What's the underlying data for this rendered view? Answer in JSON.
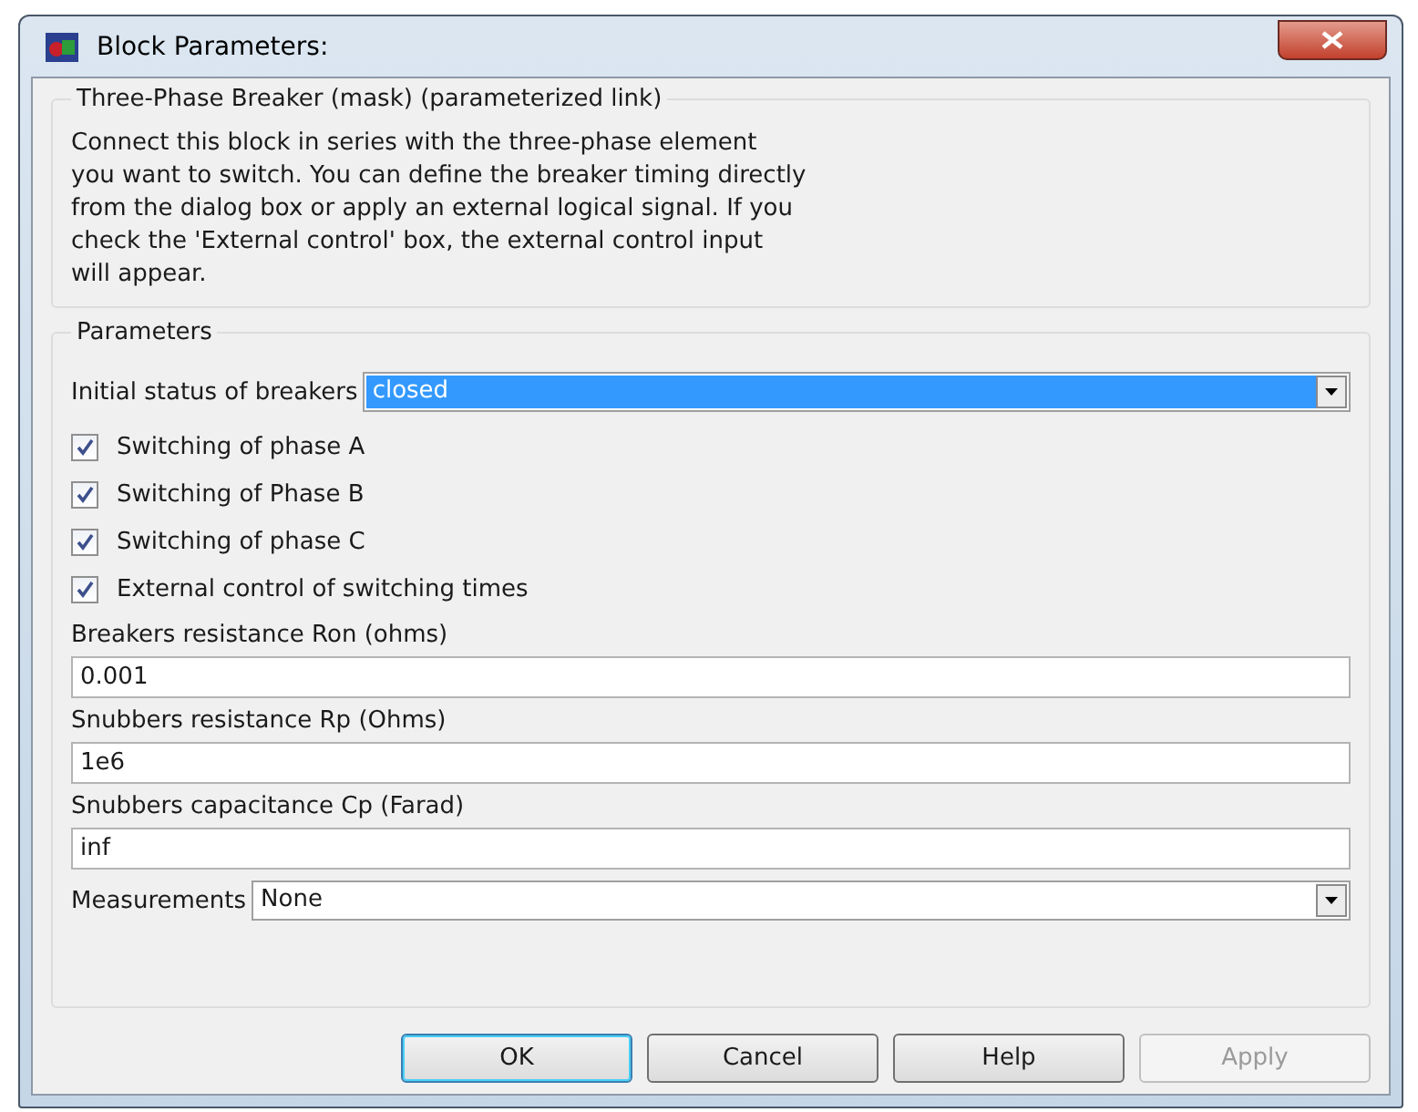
{
  "window": {
    "title": "Block Parameters:"
  },
  "description_group": {
    "title": "Three-Phase Breaker (mask) (parameterized link)",
    "text": "Connect this block in series with the three-phase element\nyou want to switch. You can define the breaker timing directly\nfrom the dialog box or apply an external logical signal. If you\ncheck  the 'External control' box, the external control input\nwill appear."
  },
  "parameters": {
    "title": "Parameters",
    "items": [
      {
        "kind": "dropdown",
        "label": "Initial status of breakers",
        "value": "closed",
        "focused": true
      },
      {
        "kind": "checkbox",
        "label": "Switching of phase A",
        "checked": true
      },
      {
        "kind": "checkbox",
        "label": "Switching of Phase B",
        "checked": true
      },
      {
        "kind": "checkbox",
        "label": "Switching of phase C",
        "checked": true
      },
      {
        "kind": "checkbox",
        "label": "External control of switching times",
        "checked": true
      },
      {
        "kind": "text",
        "label": "Breakers resistance Ron (ohms)",
        "value": "0.001"
      },
      {
        "kind": "text",
        "label": "Snubbers resistance Rp (Ohms)",
        "value": "1e6"
      },
      {
        "kind": "text",
        "label": "Snubbers capacitance Cp (Farad)",
        "value": "inf"
      },
      {
        "kind": "dropdown",
        "label": "Measurements",
        "value": "None",
        "focused": false
      }
    ]
  },
  "buttons": [
    {
      "label": "OK",
      "default": true,
      "disabled": false
    },
    {
      "label": "Cancel",
      "default": false,
      "disabled": false
    },
    {
      "label": "Help",
      "default": false,
      "disabled": false
    },
    {
      "label": "Apply",
      "default": false,
      "disabled": true
    }
  ]
}
